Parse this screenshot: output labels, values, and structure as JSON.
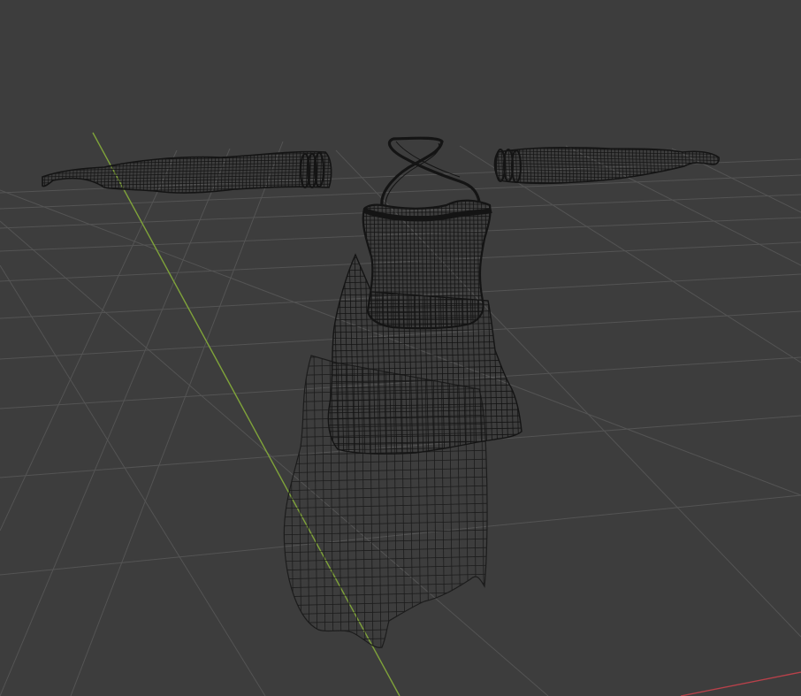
{
  "viewport": {
    "background": "#3d3d3d",
    "grid_color": "#545454",
    "y_axis_color": "#7fa33a",
    "x_axis_color": "#b8414a",
    "wire_color": "#141414",
    "wire_color_light": "#1c1c1c"
  },
  "scene_objects": [
    {
      "name": "dress-bodice",
      "type": "wireframe-mesh"
    },
    {
      "name": "dress-skirt-inner",
      "type": "wireframe-mesh"
    },
    {
      "name": "dress-skirt-outer",
      "type": "wireframe-mesh"
    },
    {
      "name": "halter-neck-strap",
      "type": "wireframe-mesh"
    },
    {
      "name": "left-sleeve",
      "type": "wireframe-mesh"
    },
    {
      "name": "right-sleeve",
      "type": "wireframe-mesh"
    }
  ]
}
